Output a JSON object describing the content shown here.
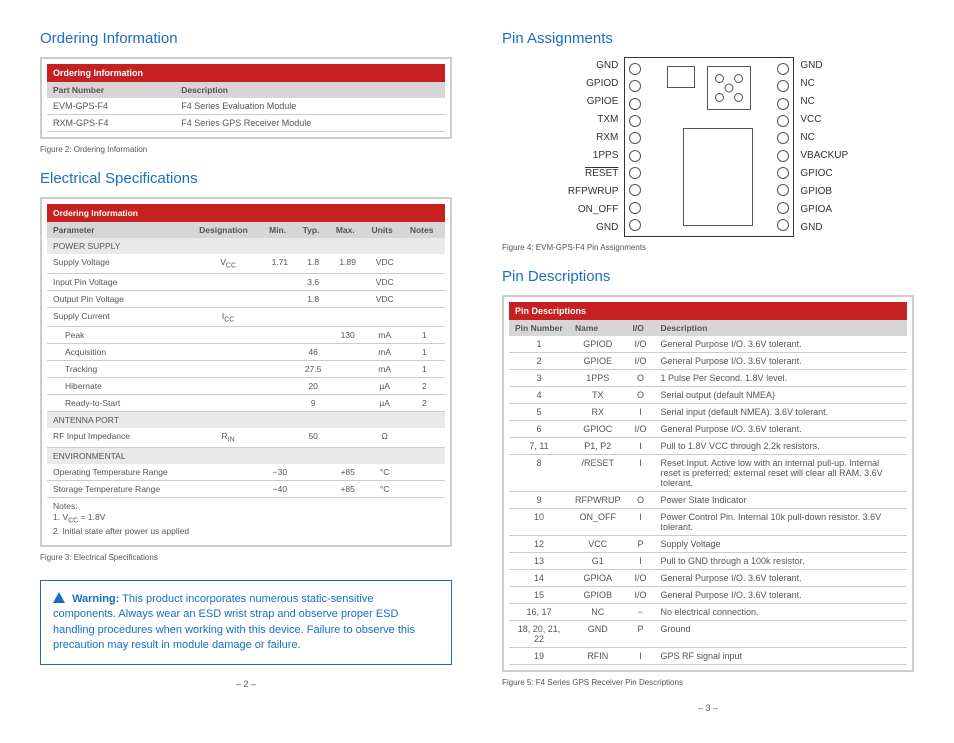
{
  "left": {
    "ordering_heading": "Ordering Information",
    "ordering_table": {
      "title": "Ordering Information",
      "headers": [
        "Part Number",
        "Description"
      ],
      "rows": [
        [
          "EVM-GPS-F4",
          "F4 Series Evaluation Module"
        ],
        [
          "RXM-GPS-F4",
          "F4 Series GPS Receiver Module"
        ]
      ]
    },
    "ordering_caption": "Figure 2:  Ordering Information",
    "elec_heading": "Electrical Specifications",
    "elec_table": {
      "title": "Ordering Information",
      "headers": [
        "Parameter",
        "Designation",
        "Min.",
        "Typ.",
        "Max.",
        "Units",
        "Notes"
      ],
      "sections": {
        "power": "POWER SUPPLY",
        "antenna": "ANTENNA PORT",
        "env": "ENVIRONMENTAL"
      },
      "rows": {
        "supply_voltage": [
          "Supply Voltage",
          "V_CC",
          "1.71",
          "1.8",
          "1.89",
          "VDC",
          ""
        ],
        "input_pin": [
          "Input Pin Voltage",
          "",
          "",
          "3.6",
          "",
          "VDC",
          ""
        ],
        "output_pin": [
          "Output Pin Voltage",
          "",
          "",
          "1.8",
          "",
          "VDC",
          ""
        ],
        "supply_current": [
          "Supply Current",
          "I_CC",
          "",
          "",
          "",
          "",
          ""
        ],
        "peak": [
          "Peak",
          "",
          "",
          "",
          "130",
          "mA",
          "1"
        ],
        "acq": [
          "Acquisition",
          "",
          "",
          "46",
          "",
          "mA",
          "1"
        ],
        "track": [
          "Tracking",
          "",
          "",
          "27.5",
          "",
          "mA",
          "1"
        ],
        "hib": [
          "Hibernate",
          "",
          "",
          "20",
          "",
          "µA",
          "2"
        ],
        "ready": [
          "Ready-to-Start",
          "",
          "",
          "9",
          "",
          "µA",
          "2"
        ],
        "rf": [
          "RF Input Impedance",
          "R_IN",
          "",
          "50",
          "",
          "Ω",
          ""
        ],
        "op_temp": [
          "Operating Temperature Range",
          "",
          "−30",
          "",
          "+85",
          "°C",
          ""
        ],
        "st_temp": [
          "Storage Temperature Range",
          "",
          "−40",
          "",
          "+85",
          "°C",
          ""
        ]
      },
      "notes": "Notes:\n1. V_CC = 1.8V\n2. Initial state after power us applied"
    },
    "elec_caption": "Figure 3:  Electrical Specifications",
    "warning": {
      "label": "Warning:",
      "text": "This product incorporates numerous static-sensitive components. Always wear an ESD wrist strap and observe proper ESD handling procedures when working with this device. Failure to observe this precaution may result in module damage or failure."
    },
    "page": "– 2 –"
  },
  "right": {
    "pa_heading": "Pin Assignments",
    "pa_left": [
      "GND",
      "GPIOD",
      "GPIOE",
      "TXM",
      "RXM",
      "1PPS",
      "RESET",
      "RFPWRUP",
      "ON_OFF",
      "GND"
    ],
    "pa_right": [
      "GND",
      "NC",
      "NC",
      "VCC",
      "NC",
      "VBACKUP",
      "GPIOC",
      "GPIOB",
      "GPIOA",
      "GND"
    ],
    "pa_caption": "Figure 4:  EVM-GPS-F4 Pin Assignments",
    "pd_heading": "Pin Descriptions",
    "pd_table": {
      "title": "Pin Descriptions",
      "headers": [
        "Pin Number",
        "Name",
        "I/O",
        "Description"
      ],
      "rows": [
        [
          "1",
          "GPIOD",
          "I/O",
          "General Purpose I/O. 3.6V tolerant."
        ],
        [
          "2",
          "GPIOE",
          "I/O",
          "General Purpose I/O. 3.6V tolerant."
        ],
        [
          "3",
          "1PPS",
          "O",
          "1 Pulse Per Second. 1.8V level."
        ],
        [
          "4",
          "TX",
          "O",
          "Serial output (default NMEA)"
        ],
        [
          "5",
          "RX",
          "I",
          "Serial input (default NMEA). 3.6V tolerant."
        ],
        [
          "6",
          "GPIOC",
          "I/O",
          "General Purpose I/O. 3.6V tolerant."
        ],
        [
          "7, 11",
          "P1, P2",
          "I",
          "Pull to 1.8V VCC through 2.2k resistors."
        ],
        [
          "8",
          "/RESET",
          "I",
          "Reset Input. Active low with an internal pull-up. Internal reset is preferred; external reset will clear all RAM. 3.6V tolerant."
        ],
        [
          "9",
          "RFPWRUP",
          "O",
          "Power State Indicator"
        ],
        [
          "10",
          "ON_OFF",
          "I",
          "Power Control Pin. Internal 10k pull-down resistor. 3.6V tolerant."
        ],
        [
          "12",
          "VCC",
          "P",
          "Supply Voltage"
        ],
        [
          "13",
          "G1",
          "I",
          "Pull to GND through a 100k resistor."
        ],
        [
          "14",
          "GPIOA",
          "I/O",
          "General Purpose I/O. 3.6V tolerant."
        ],
        [
          "15",
          "GPIOB",
          "I/O",
          "General Purpose I/O. 3.6V tolerant."
        ],
        [
          "16, 17",
          "NC",
          "−",
          "No electrical connection."
        ],
        [
          "18, 20, 21, 22",
          "GND",
          "P",
          "Ground"
        ],
        [
          "19",
          "RFIN",
          "I",
          "GPS RF signal input"
        ]
      ]
    },
    "pd_caption": "Figure 5: F4 Series GPS Receiver Pin Descriptions",
    "page": "– 3 –"
  }
}
